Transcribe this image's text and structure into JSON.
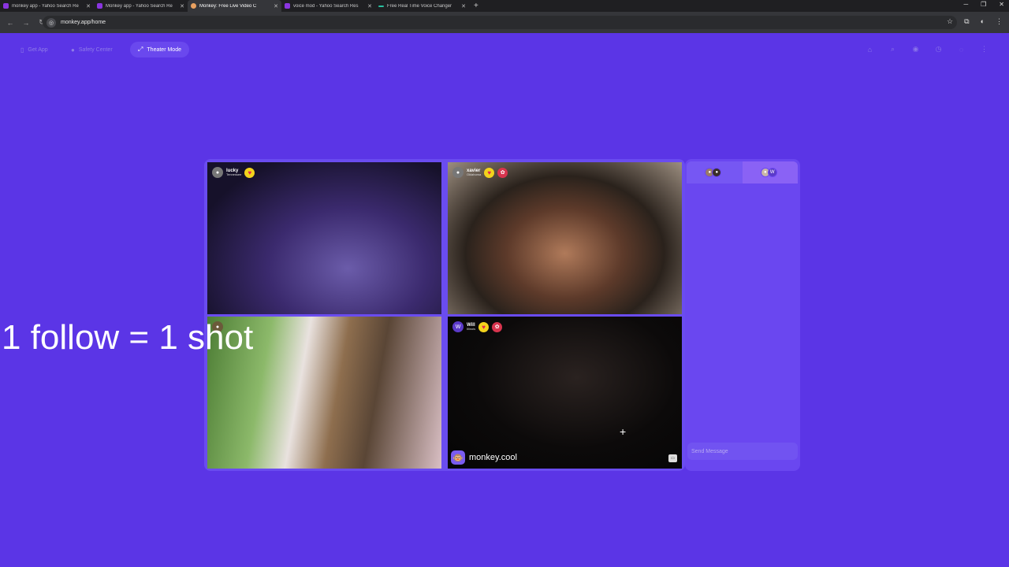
{
  "browser": {
    "tabs": [
      {
        "title": "monkey app - Yahoo Search Re",
        "color": "#8a35e0"
      },
      {
        "title": "Monkey app - Yahoo Search Re",
        "color": "#8a35e0"
      },
      {
        "title": "Monkey: Free Live Video C",
        "color": "#e8a060",
        "active": true
      },
      {
        "title": "voice mod - Yahoo Search Res",
        "color": "#8a35e0"
      },
      {
        "title": "Free Real Time Voice Changer",
        "color": "#2ac0a0"
      }
    ],
    "url": "monkey.app/home"
  },
  "toolbar": {
    "get_app": "Get App",
    "safety_center": "Safety Center",
    "theater_mode": "Theater Mode"
  },
  "videos": [
    {
      "name": "lucky",
      "location": "Tennessee"
    },
    {
      "name": "xavier",
      "location": "Oklahoma"
    },
    {
      "name": "",
      "location": ""
    },
    {
      "name": "Will",
      "location": "Illinois",
      "avatar": "W"
    }
  ],
  "brand": {
    "text": "monkey.cool"
  },
  "chat": {
    "placeholder": "Send Message",
    "avatar_letter": "W"
  },
  "overlay_text": "1 follow = 1 shot",
  "colors": {
    "page_bg": "#5b35e6",
    "accent": "#6a47f0"
  }
}
